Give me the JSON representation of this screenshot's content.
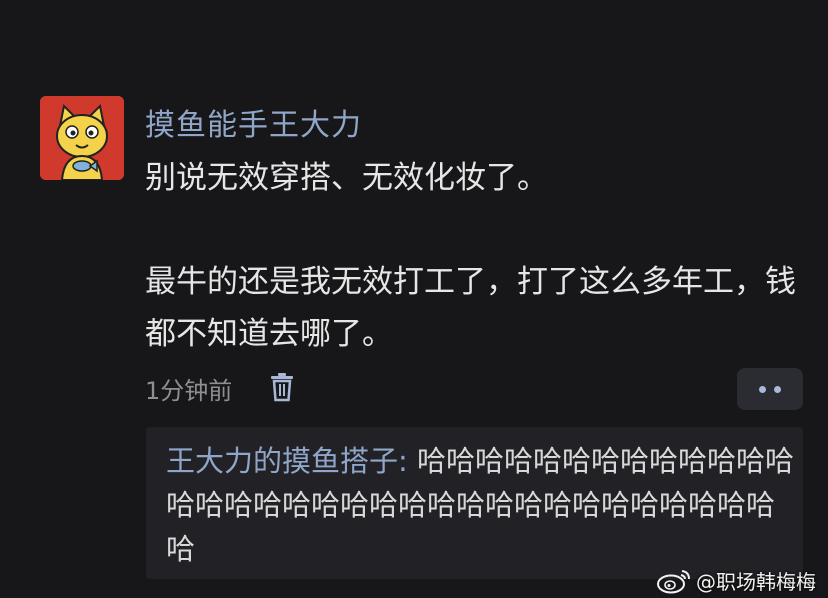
{
  "comment": {
    "username": "摸鱼能手王大力",
    "paragraphs": [
      "别说无效穿搭、无效化妆了。",
      "最牛的还是我无效打工了，打了这么多年工，钱都不知道去哪了。"
    ],
    "time": "1分钟前",
    "delete_icon": "trash-icon",
    "more_icon": "more-dots-icon"
  },
  "reply": {
    "author": "王大力的摸鱼搭子",
    "separator": ": ",
    "text": "哈哈哈哈哈哈哈哈哈哈哈哈哈哈哈哈哈哈哈哈哈哈哈哈哈哈哈哈哈哈哈哈哈哈哈"
  },
  "watermark": {
    "logo": "weibo-logo-icon",
    "text": "@职场韩梅梅"
  },
  "colors": {
    "background": "#171719",
    "username": "#8fa6c8",
    "avatar_bg": "#cf3a2d",
    "reply_bg": "#222226"
  }
}
